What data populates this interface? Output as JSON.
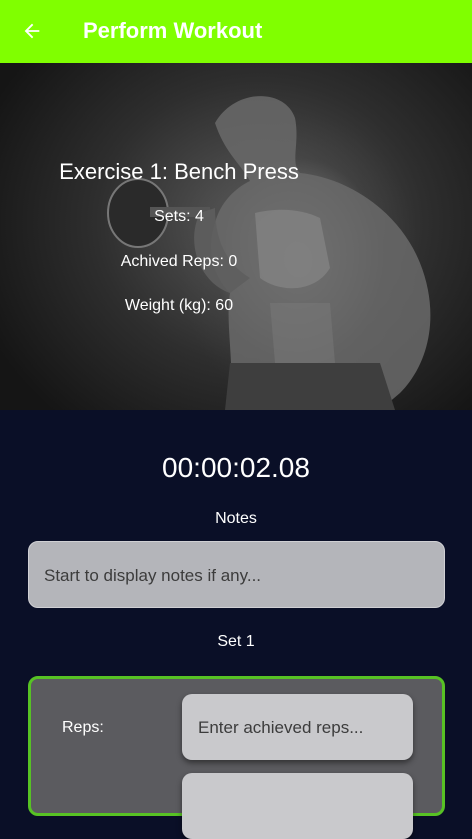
{
  "app_bar": {
    "title": "Perform Workout",
    "back_icon": "arrow-left-icon",
    "color": "#80ff00"
  },
  "exercise": {
    "title": "Exercise 1: Bench Press",
    "sets": "Sets: 4",
    "achieved_reps": "Achived Reps: 0",
    "weight": "Weight (kg): 60"
  },
  "timer": "00:00:02.08",
  "notes": {
    "label": "Notes",
    "placeholder": "Start to display notes if any..."
  },
  "set": {
    "label": "Set 1",
    "reps_label": "Reps:",
    "reps_placeholder": "Enter achieved reps...",
    "border_color": "#57c224"
  }
}
